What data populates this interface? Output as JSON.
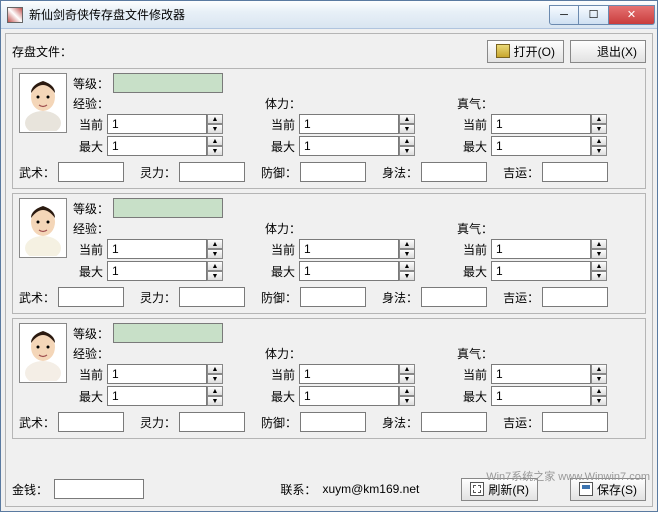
{
  "window_title": "新仙剑奇侠传存盘文件修改器",
  "header": {
    "save_file_label": "存盘文件：",
    "open_btn": "打开(O)",
    "exit_btn": "退出(X)"
  },
  "labels": {
    "level": "等级：",
    "exp": "经验：",
    "hp": "体力：",
    "mp": "真气：",
    "current": "当前",
    "max": "最大",
    "wushu": "武术：",
    "lingli": "灵力：",
    "fangyu": "防御：",
    "shenfa": "身法：",
    "jiyun": "吉运："
  },
  "characters": [
    {
      "level": "",
      "exp_cur": "1",
      "exp_max": "1",
      "hp_cur": "1",
      "hp_max": "1",
      "mp_cur": "1",
      "mp_max": "1",
      "wushu": "",
      "lingli": "",
      "fangyu": "",
      "shenfa": "",
      "jiyun": ""
    },
    {
      "level": "",
      "exp_cur": "1",
      "exp_max": "1",
      "hp_cur": "1",
      "hp_max": "1",
      "mp_cur": "1",
      "mp_max": "1",
      "wushu": "",
      "lingli": "",
      "fangyu": "",
      "shenfa": "",
      "jiyun": ""
    },
    {
      "level": "",
      "exp_cur": "1",
      "exp_max": "1",
      "hp_cur": "1",
      "hp_max": "1",
      "mp_cur": "1",
      "mp_max": "1",
      "wushu": "",
      "lingli": "",
      "fangyu": "",
      "shenfa": "",
      "jiyun": ""
    }
  ],
  "footer": {
    "money_label": "金钱：",
    "money": "",
    "contact_label": "联系：",
    "contact_value": "xuym@km169.net",
    "refresh_btn": "刷新(R)",
    "save_btn": "保存(S)"
  },
  "watermark": "Win7系统之家  www.Winwin7.com"
}
